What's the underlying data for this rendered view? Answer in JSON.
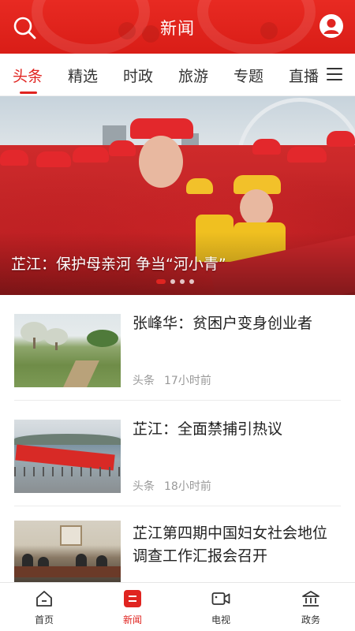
{
  "header": {
    "title": "新闻",
    "search_icon": "search-icon",
    "user_icon": "user-avatar-icon",
    "color": "#e02420"
  },
  "tabs": [
    {
      "label": "头条",
      "active": true
    },
    {
      "label": "精选"
    },
    {
      "label": "时政"
    },
    {
      "label": "旅游"
    },
    {
      "label": "专题"
    },
    {
      "label": "直播"
    }
  ],
  "tabs_menu_icon": "menu-icon",
  "hero": {
    "caption": "芷江：保护母亲河 争当“河小青”",
    "slides_total": 4,
    "active_slide": 1
  },
  "news": [
    {
      "title": "张峰华：贫困户变身创业者",
      "category": "头条",
      "time": "17小时前",
      "thumb": "orchard-photo"
    },
    {
      "title": "芷江：全面禁捕引热议",
      "category": "头条",
      "time": "18小时前",
      "thumb": "riverside-banner-photo"
    },
    {
      "title": "芷江第四期中国妇女社会地位调查工作汇报会召开",
      "category": "",
      "time": "",
      "thumb": "meeting-photo"
    }
  ],
  "bottom_nav": [
    {
      "label": "首页",
      "icon": "home-icon"
    },
    {
      "label": "新闻",
      "icon": "news-icon",
      "active": true
    },
    {
      "label": "电视",
      "icon": "tv-icon"
    },
    {
      "label": "政务",
      "icon": "government-icon"
    }
  ],
  "colors": {
    "accent": "#e02420",
    "text": "#222222",
    "meta": "#999999"
  }
}
